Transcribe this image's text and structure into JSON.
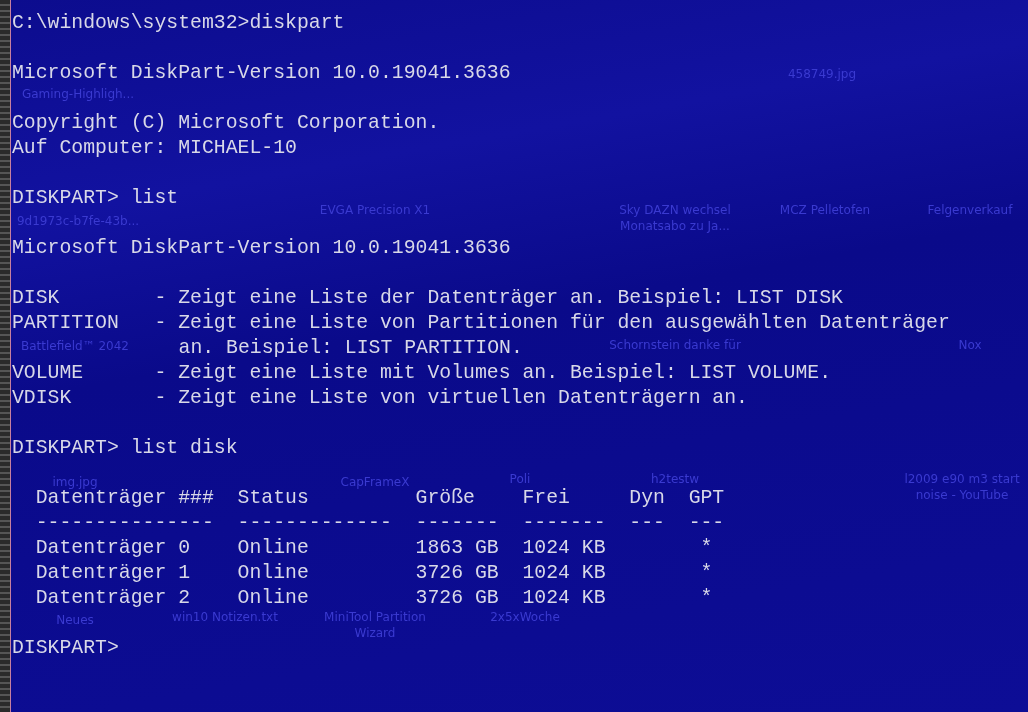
{
  "desktop": {
    "icons": [
      {
        "label": "458749.jpg"
      },
      {
        "label": "Gaming-Highligh..."
      },
      {
        "label": "9d1973c-b7fe-43b..."
      },
      {
        "label": "EVGA Precision X1"
      },
      {
        "label": "Sky DAZN wechsel Monatsabo zu Ja..."
      },
      {
        "label": "MCZ Pelletofen"
      },
      {
        "label": "Felgenverkauf"
      },
      {
        "label": "Battlefield™ 2042"
      },
      {
        "label": "Schornstein danke für"
      },
      {
        "label": "Nox"
      },
      {
        "label": "img.jpg"
      },
      {
        "label": "CapFrameX"
      },
      {
        "label": "Poli"
      },
      {
        "label": "h2testw"
      },
      {
        "label": "l2009 e90 m3 start noise - YouTube"
      },
      {
        "label": "Neues"
      },
      {
        "label": "win10 Notizen.txt"
      },
      {
        "label": "MiniTool Partition Wizard"
      },
      {
        "label": "2x5xWoche"
      }
    ]
  },
  "terminal": {
    "blocks": [
      [
        "C:\\windows\\system32>diskpart"
      ],
      [
        "Microsoft DiskPart-Version 10.0.19041.3636"
      ],
      [
        "Copyright (C) Microsoft Corporation.",
        "Auf Computer: MICHAEL-10"
      ],
      [
        "DISKPART> list"
      ],
      [
        "Microsoft DiskPart-Version 10.0.19041.3636"
      ],
      [
        "DISK        - Zeigt eine Liste der Datenträger an. Beispiel: LIST DISK",
        "PARTITION   - Zeigt eine Liste von Partitionen für den ausgewählten Datenträger",
        {
          "kind": "continuation",
          "text": "an. Beispiel: LIST PARTITION."
        },
        "VOLUME      - Zeigt eine Liste mit Volumes an. Beispiel: LIST VOLUME.",
        "VDISK       - Zeigt eine Liste von virtuellen Datenträgern an."
      ],
      [
        "DISKPART> list disk"
      ],
      [
        "  Datenträger ###  Status         Größe    Frei     Dyn  GPT",
        "  ---------------  -------------  -------  -------  ---  ---",
        "  Datenträger 0    Online         1863 GB  1024 KB        *",
        "  Datenträger 1    Online         3726 GB  1024 KB        *",
        "  Datenträger 2    Online         3726 GB  1024 KB        *"
      ],
      [
        "DISKPART>"
      ]
    ]
  }
}
